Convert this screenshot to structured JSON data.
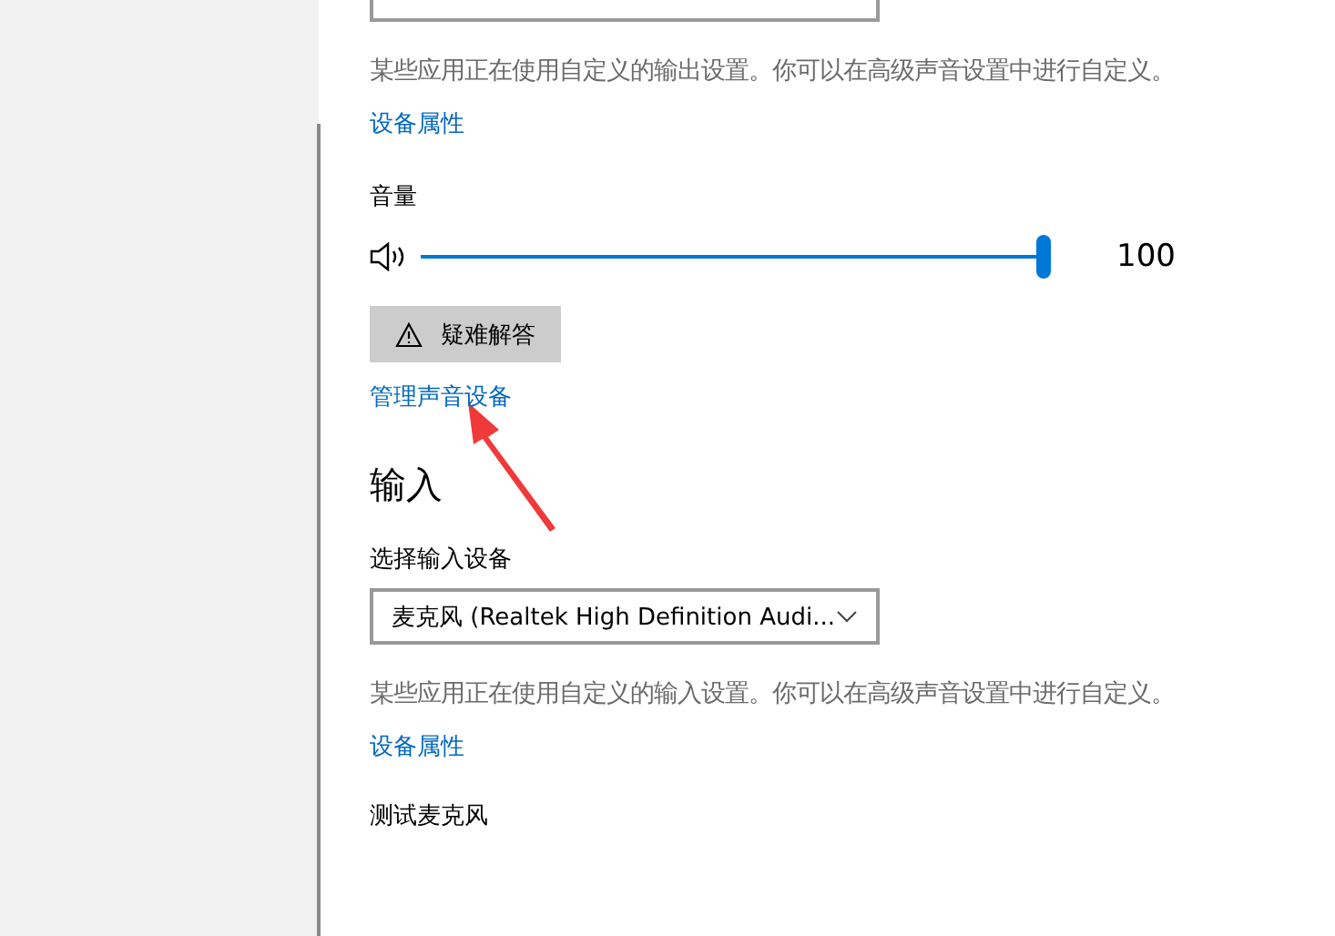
{
  "output": {
    "note": "某些应用正在使用自定义的输出设置。你可以在高级声音设置中进行自定义。",
    "properties_link": "设备属性",
    "volume": {
      "label": "音量",
      "level": 1.0,
      "reading": "100"
    },
    "troubleshoot_button": "疑难解答",
    "manage_link": "管理声音设备"
  },
  "input": {
    "heading": "输入",
    "select_label": "选择输入设备",
    "device": "麦克风 (Realtek High Definition Audi...",
    "note": "某些应用正在使用自定义的输入设置。你可以在高级声音设置中进行自定义。",
    "properties_link": "设备属性",
    "test_label": "测试麦克风"
  }
}
